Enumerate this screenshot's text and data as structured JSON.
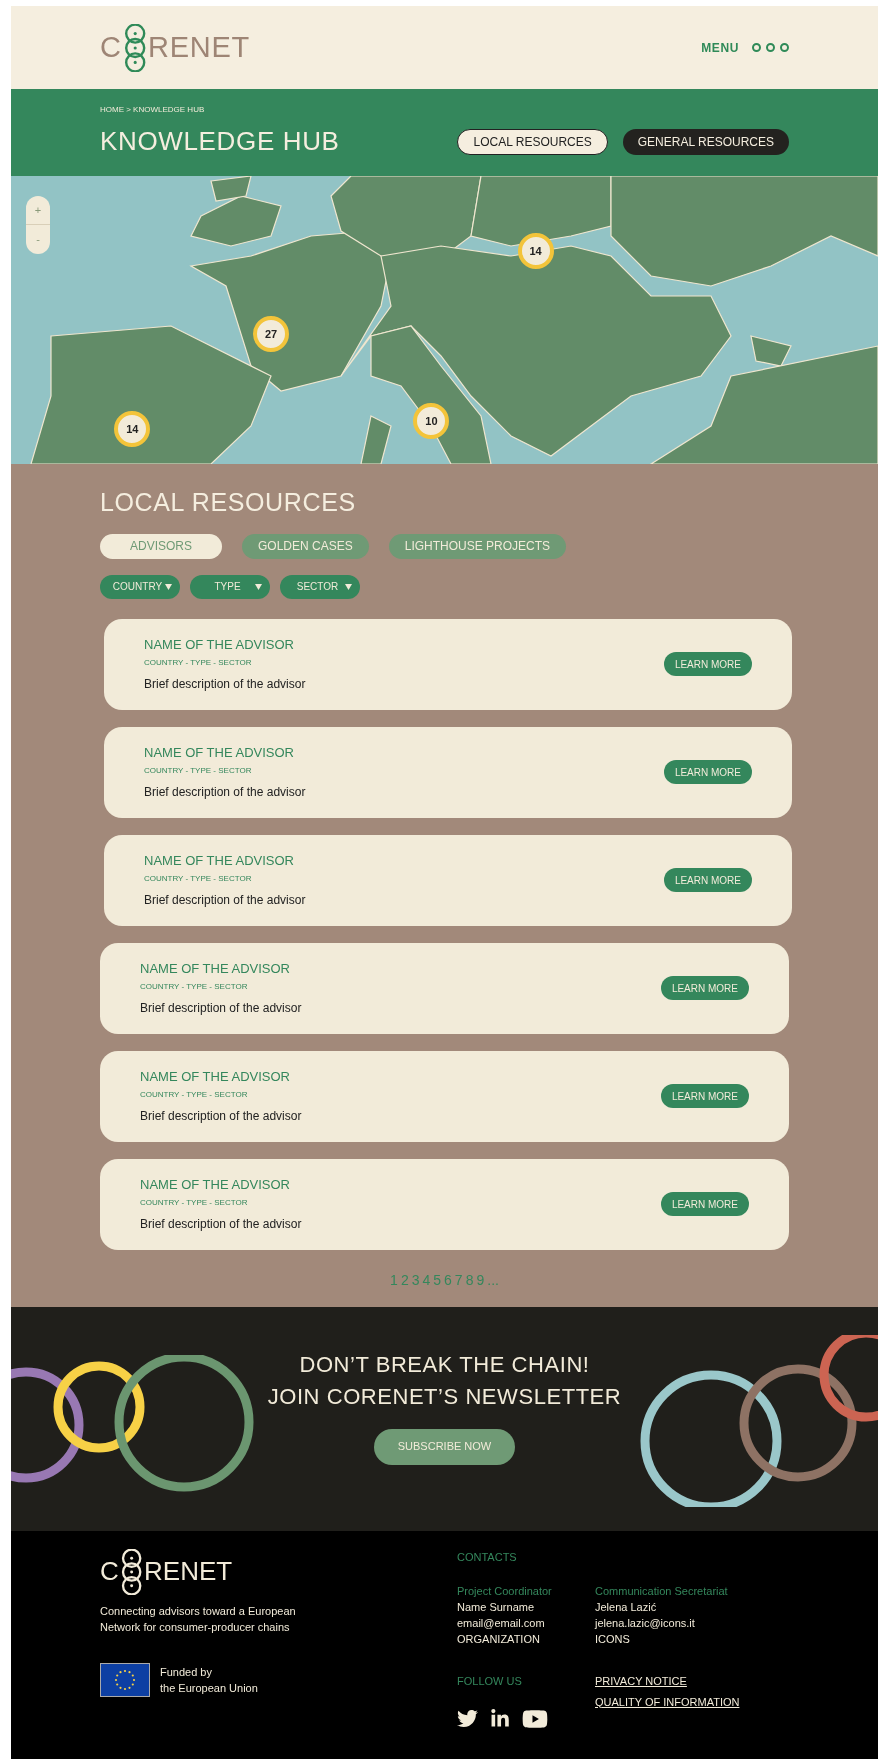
{
  "header": {
    "logo": {
      "before": "C",
      "after": "RENET"
    },
    "menu": "MENU"
  },
  "hero": {
    "breadcrumb": "HOME > KNOWLEDGE HUB",
    "title": "KNOWLEDGE HUB",
    "tabs": [
      {
        "label": "LOCAL RESOURCES",
        "selected": true
      },
      {
        "label": "GENERAL RESOURCES",
        "selected": false
      }
    ]
  },
  "map": {
    "zoom": [
      "+",
      "-"
    ],
    "markers": [
      "14",
      "27",
      "10",
      "14"
    ]
  },
  "local": {
    "title": "LOCAL RESOURCES",
    "tabs": [
      {
        "label": "ADVISORS",
        "selected": true
      },
      {
        "label": "GOLDEN CASES",
        "selected": false
      },
      {
        "label": "LIGHTHOUSE PROJECTS",
        "selected": false
      }
    ],
    "filters": [
      "COUNTRY",
      "TYPE",
      "SECTOR"
    ],
    "cards": [
      {
        "name": "NAME OF THE ADVISOR",
        "meta": "COUNTRY - TYPE - SECTOR",
        "description": "Brief description of the advisor",
        "button": "LEARN MORE"
      },
      {
        "name": "NAME OF THE ADVISOR",
        "meta": "COUNTRY - TYPE - SECTOR",
        "description": "Brief description of the advisor",
        "button": "LEARN MORE"
      },
      {
        "name": "NAME OF THE ADVISOR",
        "meta": "COUNTRY - TYPE - SECTOR",
        "description": "Brief description of the advisor",
        "button": "LEARN MORE"
      },
      {
        "name": "NAME OF THE ADVISOR",
        "meta": "COUNTRY - TYPE - SECTOR",
        "description": "Brief description of the advisor",
        "button": "LEARN MORE"
      },
      {
        "name": "NAME OF THE ADVISOR",
        "meta": "COUNTRY - TYPE - SECTOR",
        "description": "Brief description of the advisor",
        "button": "LEARN MORE"
      },
      {
        "name": "NAME OF THE ADVISOR",
        "meta": "COUNTRY - TYPE - SECTOR",
        "description": "Brief description of the advisor",
        "button": "LEARN MORE"
      }
    ],
    "pagination": [
      "1",
      "2",
      "3",
      "4",
      "5",
      "6",
      "7",
      "8",
      "9",
      "..."
    ]
  },
  "newsletter": {
    "lines": [
      "DON’T BREAK THE CHAIN!",
      "JOIN CORENET’S NEWSLETTER"
    ],
    "button": "SUBSCRIBE NOW"
  },
  "footer": {
    "logo": {
      "before": "C",
      "after": "RENET"
    },
    "tagline": "Connecting advisors toward a European Network for consumer-producer chains",
    "funded": [
      "Funded by",
      "the European Union"
    ],
    "contacts_title": "CONTACTS",
    "contacts": [
      {
        "role": "Project Coordinator",
        "lines": [
          "Name Surname",
          "email@email.com",
          "ORGANIZATION"
        ]
      },
      {
        "role": "Communication Secretariat",
        "lines": [
          "Jelena Lazić",
          "jelena.lazic@icons.it",
          "ICONS"
        ]
      }
    ],
    "follow": "FOLLOW US",
    "links": [
      "PRIVACY NOTICE",
      "QUALITY OF INFORMATION"
    ]
  }
}
